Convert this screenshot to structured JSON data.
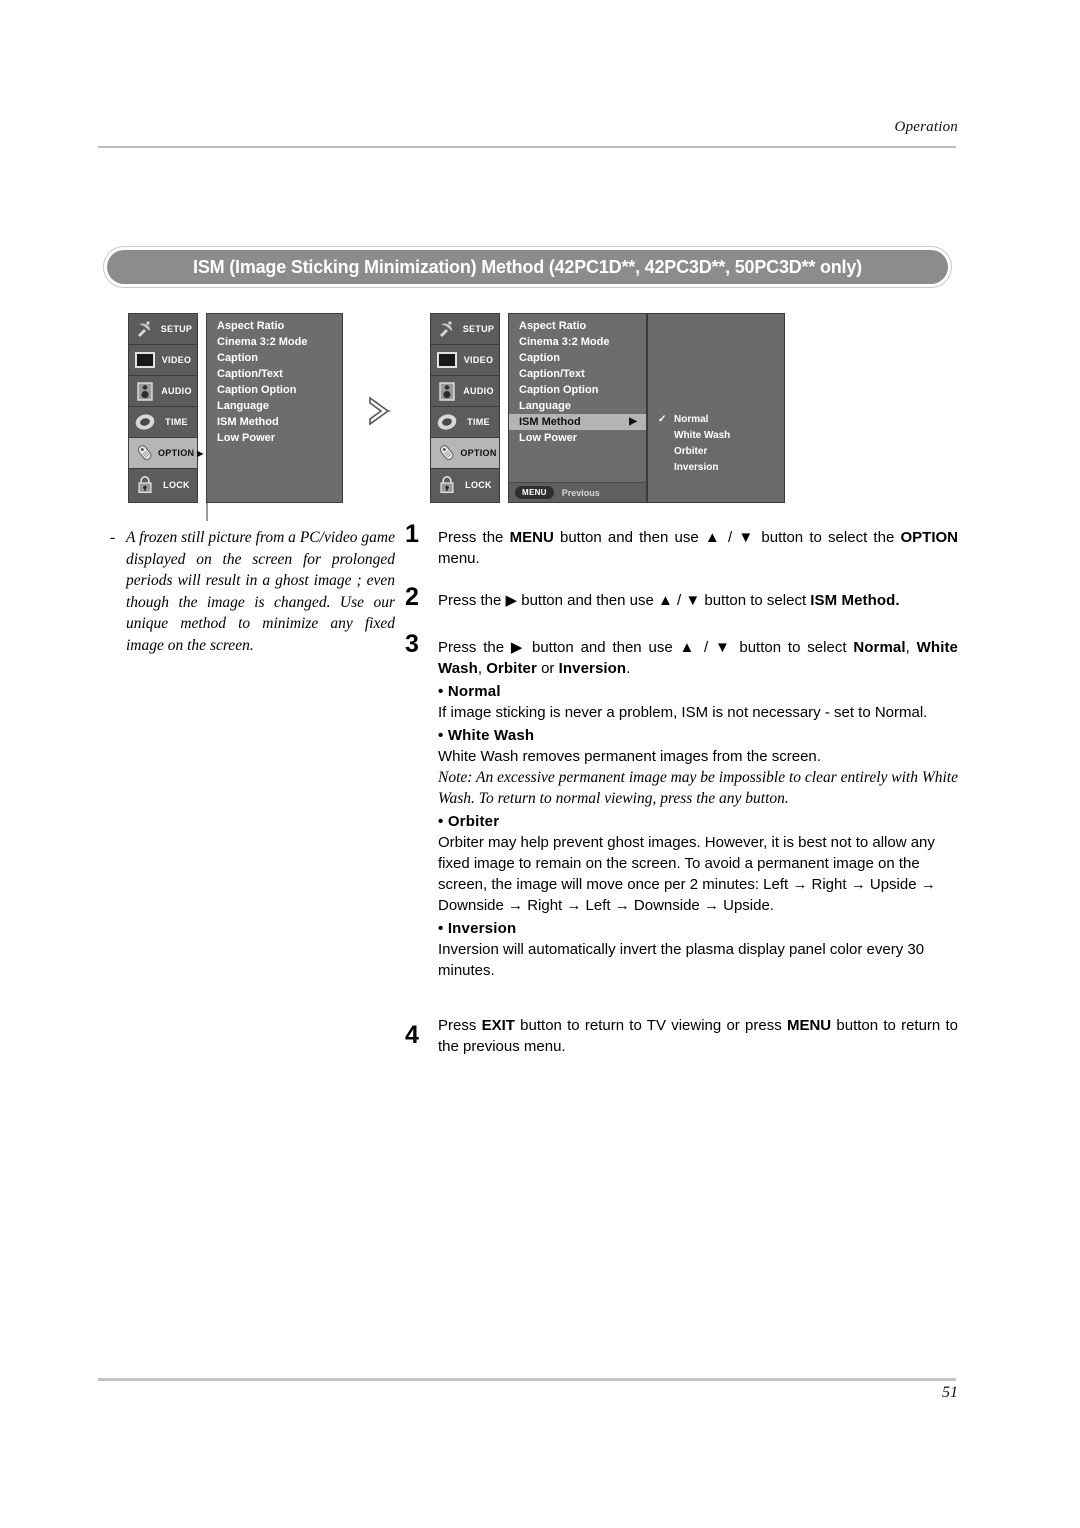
{
  "header": {
    "running_head": "Operation"
  },
  "footer": {
    "page_number": "51"
  },
  "section": {
    "title": "ISM (Image Sticking Minimization) Method (42PC1D**, 42PC3D**, 50PC3D** only)"
  },
  "osd": {
    "sidebar": [
      {
        "label": "SETUP",
        "icon": "satellite-dish-icon",
        "selected": false,
        "caret": ""
      },
      {
        "label": "VIDEO",
        "icon": "monitor-icon",
        "selected": false,
        "caret": ""
      },
      {
        "label": "AUDIO",
        "icon": "speaker-icon",
        "selected": false,
        "caret": ""
      },
      {
        "label": "TIME",
        "icon": "clock-icon",
        "selected": false,
        "caret": ""
      },
      {
        "label": "OPTION",
        "icon": "tag-icon",
        "selected": true,
        "caret": "▶"
      },
      {
        "label": "LOCK",
        "icon": "padlock-icon",
        "selected": false,
        "caret": ""
      }
    ],
    "sidebar_step2": [
      {
        "label": "SETUP",
        "icon": "satellite-dish-icon",
        "selected": false,
        "caret": ""
      },
      {
        "label": "VIDEO",
        "icon": "monitor-icon",
        "selected": false,
        "caret": ""
      },
      {
        "label": "AUDIO",
        "icon": "speaker-icon",
        "selected": false,
        "caret": ""
      },
      {
        "label": "TIME",
        "icon": "clock-icon",
        "selected": false,
        "caret": ""
      },
      {
        "label": "OPTION",
        "icon": "tag-icon",
        "selected": true,
        "caret": ""
      },
      {
        "label": "LOCK",
        "icon": "padlock-icon",
        "selected": false,
        "caret": ""
      }
    ],
    "option_menu": [
      {
        "label": "Aspect Ratio",
        "highlighted": false,
        "caret": ""
      },
      {
        "label": "Cinema 3:2 Mode",
        "highlighted": false,
        "caret": ""
      },
      {
        "label": "Caption",
        "highlighted": false,
        "caret": ""
      },
      {
        "label": "Caption/Text",
        "highlighted": false,
        "caret": ""
      },
      {
        "label": "Caption Option",
        "highlighted": false,
        "caret": ""
      },
      {
        "label": "Language",
        "highlighted": false,
        "caret": ""
      },
      {
        "label": "ISM Method",
        "highlighted": false,
        "caret": ""
      },
      {
        "label": "Low Power",
        "highlighted": false,
        "caret": ""
      }
    ],
    "option_menu_step2": [
      {
        "label": "Aspect Ratio",
        "highlighted": false,
        "caret": ""
      },
      {
        "label": "Cinema 3:2 Mode",
        "highlighted": false,
        "caret": ""
      },
      {
        "label": "Caption",
        "highlighted": false,
        "caret": ""
      },
      {
        "label": "Caption/Text",
        "highlighted": false,
        "caret": ""
      },
      {
        "label": "Caption Option",
        "highlighted": false,
        "caret": ""
      },
      {
        "label": "Language",
        "highlighted": false,
        "caret": ""
      },
      {
        "label": "ISM Method",
        "highlighted": true,
        "caret": "▶"
      },
      {
        "label": "Low Power",
        "highlighted": false,
        "caret": ""
      }
    ],
    "ism_options": [
      {
        "label": "Normal",
        "checked": "✓"
      },
      {
        "label": "White Wash",
        "checked": ""
      },
      {
        "label": "Orbiter",
        "checked": ""
      },
      {
        "label": "Inversion",
        "checked": ""
      }
    ],
    "footbar": {
      "menu_chip": "MENU",
      "previous_label": "Previous"
    },
    "flow_arrow": "double-chevron-right-icon"
  },
  "note": {
    "bullet": "-",
    "text": "A frozen still picture from a PC/video game displayed on the screen for prolonged periods will result in a ghost image ; even though the image is changed. Use our unique method to minimize any fixed image on the screen."
  },
  "steps": {
    "step1": {
      "number": "1",
      "pre": "Press the ",
      "b1": "MENU",
      "mid": " button and then use ▲ / ▼  button to select the ",
      "b2": "OPTION",
      "post": " menu."
    },
    "step2": {
      "number": "2",
      "pre": "Press the ▶ button and then use ▲ / ▼ button to select ",
      "b1": "ISM Method.",
      "post": ""
    },
    "step3": {
      "number": "3",
      "pre": "Press the ▶  button and then use ▲ / ▼ button to select ",
      "b1": "Normal",
      "mid": ", ",
      "b2": "White Wash",
      "mid2": ", ",
      "b3": "Orbiter",
      "mid3": " or ",
      "b4": "Inversion",
      "post": "."
    },
    "step4": {
      "number": "4",
      "pre": "Press ",
      "b1": "EXIT",
      "mid": " button to return to TV viewing or press ",
      "b2": "MENU",
      "post": " button to return to the previous menu."
    }
  },
  "modes": {
    "normal": {
      "heading": "• Normal",
      "body": "If image sticking is never a problem, ISM is not necessary - set to Normal."
    },
    "white_wash": {
      "heading": "• White Wash",
      "body": "White Wash removes permanent images from the screen.",
      "note": "Note: An excessive permanent image may be impossible to clear entirely with White Wash. To return to normal viewing, press the any button."
    },
    "orbiter": {
      "heading": "• Orbiter",
      "body": "Orbiter may help prevent ghost images. However, it is best not to allow any fixed image to remain on the screen. To avoid a permanent image on the screen, the image will move once per 2 minutes: Left → Right → Upside → Downside → Right → Left → Downside → Upside."
    },
    "inversion": {
      "heading": "• Inversion",
      "body": "Inversion will automatically invert the plasma display panel color every 30 minutes."
    }
  },
  "colors": {
    "title_pill": "#8c8c8c",
    "osd_sidebar": "#5c5c5c",
    "osd_list": "#6d6d6d",
    "osd_highlight": "#b4b4b4",
    "rule": "#bdbdbd"
  }
}
